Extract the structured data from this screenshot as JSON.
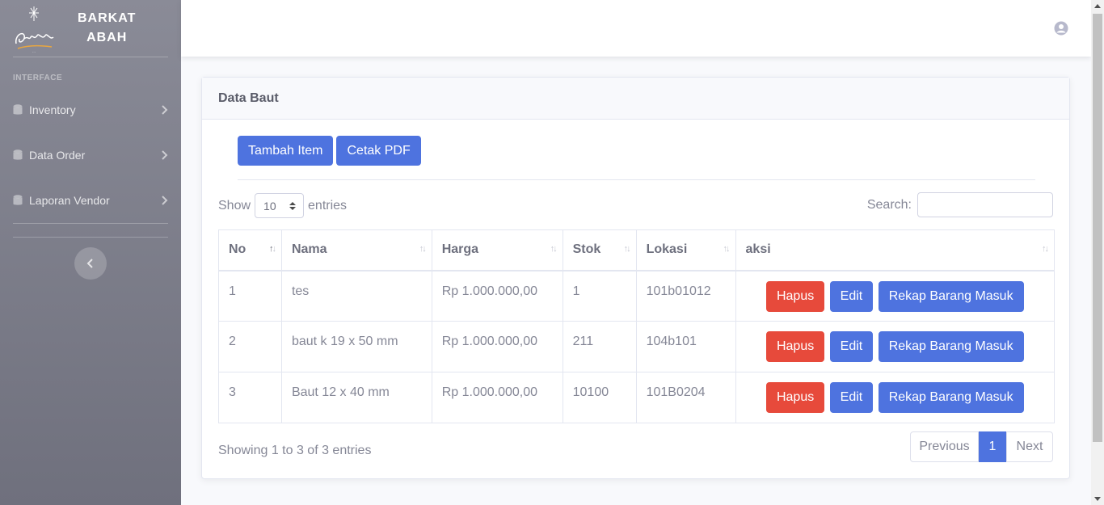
{
  "brand": {
    "line1": "BARKAT",
    "line2": "ABAH",
    "logo_text": "Barkat abah"
  },
  "sidebar": {
    "section": "INTERFACE",
    "items": [
      {
        "label": "Inventory",
        "icon": "database-icon"
      },
      {
        "label": "Data Order",
        "icon": "database-icon"
      },
      {
        "label": "Laporan Vendor",
        "icon": "database-icon"
      }
    ]
  },
  "card": {
    "title": "Data Baut"
  },
  "toolbar": {
    "add_label": "Tambah Item",
    "pdf_label": "Cetak PDF"
  },
  "table_controls": {
    "show_label": "Show",
    "entries_value": "10",
    "entries_label": "entries",
    "search_label": "Search:",
    "search_value": ""
  },
  "table": {
    "columns": [
      "No",
      "Nama",
      "Harga",
      "Stok",
      "Lokasi",
      "aksi"
    ],
    "rows": [
      {
        "no": "1",
        "nama": "tes",
        "harga": "Rp 1.000.000,00",
        "stok": "1",
        "lokasi": "101b01012"
      },
      {
        "no": "2",
        "nama": "baut k 19 x 50 mm",
        "harga": "Rp 1.000.000,00",
        "stok": "211",
        "lokasi": "104b101"
      },
      {
        "no": "3",
        "nama": "Baut 12 x 40 mm",
        "harga": "Rp 1.000.000,00",
        "stok": "10100",
        "lokasi": "101B0204"
      }
    ],
    "actions": {
      "delete": "Hapus",
      "edit": "Edit",
      "recap": "Rekap Barang Masuk"
    }
  },
  "footer": {
    "info": "Showing 1 to 3 of 3 entries",
    "prev": "Previous",
    "page": "1",
    "next": "Next"
  },
  "colors": {
    "primary": "#4e73df",
    "danger": "#e74a3b",
    "sidebar_top": "#8a8b97",
    "sidebar_bottom": "#6f707d"
  }
}
